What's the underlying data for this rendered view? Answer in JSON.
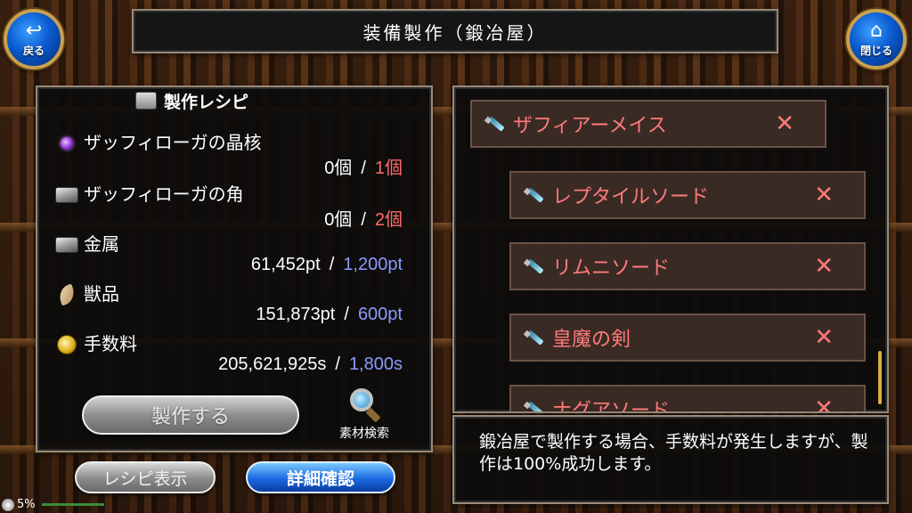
{
  "header": {
    "title": "装備製作（鍛冶屋）",
    "back_label": "戻る",
    "close_label": "閉じる"
  },
  "recipe": {
    "heading": "製作レシピ",
    "materials": [
      {
        "icon": "crystal-core-icon",
        "name": "ザッフィローガの晶核",
        "have": "0個",
        "need": "1個",
        "need_color": "#ff6a6a"
      },
      {
        "icon": "ingot-icon",
        "name": "ザッフィローガの角",
        "have": "0個",
        "need": "2個",
        "need_color": "#ff6a6a"
      },
      {
        "icon": "ingot-icon",
        "name": "金属",
        "have": "61,452pt",
        "need": "1,200pt",
        "need_color": "#8a9aff"
      },
      {
        "icon": "fang-icon",
        "name": "獣品",
        "have": "151,873pt",
        "need": "600pt",
        "need_color": "#8a9aff"
      },
      {
        "icon": "coins-icon",
        "name": "手数料",
        "have": "205,621,925s",
        "need": "1,800s",
        "need_color": "#8a9aff"
      }
    ],
    "separator": "/",
    "craft_label": "製作する",
    "search_label": "素材検索"
  },
  "buttons": {
    "recipe_show": "レシピ表示",
    "detail": "詳細確認"
  },
  "items": [
    {
      "name": "ザフィアーメイス",
      "mark": "✕"
    },
    {
      "name": "レプタイルソード",
      "mark": "✕"
    },
    {
      "name": "リムニソード",
      "mark": "✕"
    },
    {
      "name": "皇魔の剣",
      "mark": "✕"
    },
    {
      "name": "ナグアソード",
      "mark": "✕"
    }
  ],
  "message": "鍛冶屋で製作する場合、手数料が発生しますが、製作は100%成功します。",
  "status": {
    "battery": "5%"
  },
  "colors": {
    "need_red": "#ff6a6a",
    "need_blue": "#8a9aff",
    "item_red": "#ff7a7a",
    "button_blue": "#1a6ae0"
  }
}
